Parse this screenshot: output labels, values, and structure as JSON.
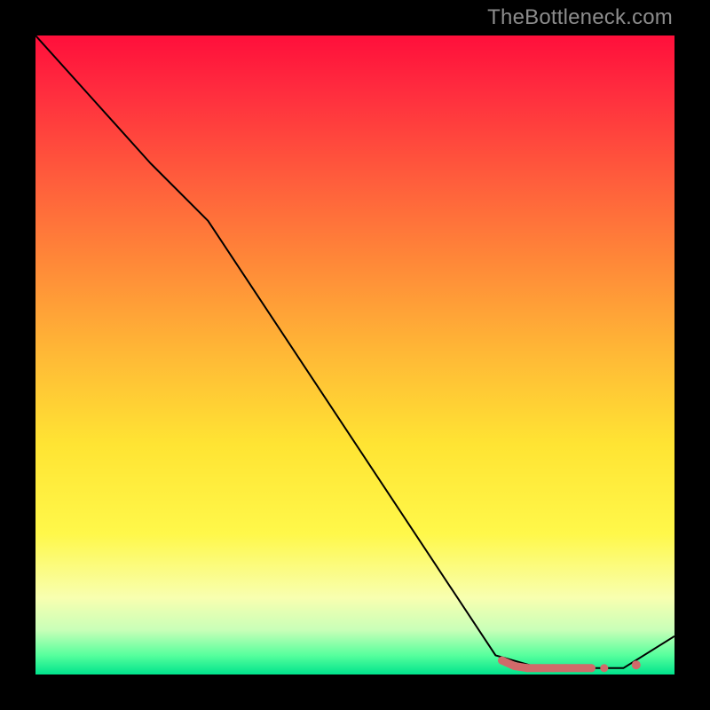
{
  "watermark": "TheBottleneck.com",
  "chart_data": {
    "type": "line",
    "title": "",
    "xlabel": "",
    "ylabel": "",
    "xlim": [
      0,
      100
    ],
    "ylim": [
      0,
      100
    ],
    "series": [
      {
        "name": "curve",
        "x": [
          0,
          9,
          18,
          27,
          72,
          79,
          85,
          92,
          100
        ],
        "y": [
          100,
          90,
          80,
          71,
          3,
          1,
          1,
          1,
          6
        ]
      }
    ],
    "markers": {
      "name": "dots",
      "color": "#d06a6a",
      "points": [
        {
          "x": 73,
          "y": 2.2
        },
        {
          "x": 75,
          "y": 1.3
        },
        {
          "x": 77,
          "y": 1.0
        },
        {
          "x": 79,
          "y": 1.0
        },
        {
          "x": 81,
          "y": 1.0
        },
        {
          "x": 83,
          "y": 1.0
        },
        {
          "x": 85,
          "y": 1.0
        },
        {
          "x": 87,
          "y": 1.0
        },
        {
          "x": 89,
          "y": 1.0
        },
        {
          "x": 94,
          "y": 1.5
        }
      ]
    },
    "gradient_stops": [
      {
        "pos": 0.0,
        "color": "#ff0f3b"
      },
      {
        "pos": 0.08,
        "color": "#ff2a3e"
      },
      {
        "pos": 0.22,
        "color": "#ff5b3c"
      },
      {
        "pos": 0.36,
        "color": "#ff8a38"
      },
      {
        "pos": 0.5,
        "color": "#ffb936"
      },
      {
        "pos": 0.64,
        "color": "#ffe433"
      },
      {
        "pos": 0.78,
        "color": "#fff84a"
      },
      {
        "pos": 0.88,
        "color": "#f8ffb0"
      },
      {
        "pos": 0.93,
        "color": "#c9ffb8"
      },
      {
        "pos": 0.97,
        "color": "#57ff9d"
      },
      {
        "pos": 1.0,
        "color": "#00e38c"
      }
    ]
  }
}
